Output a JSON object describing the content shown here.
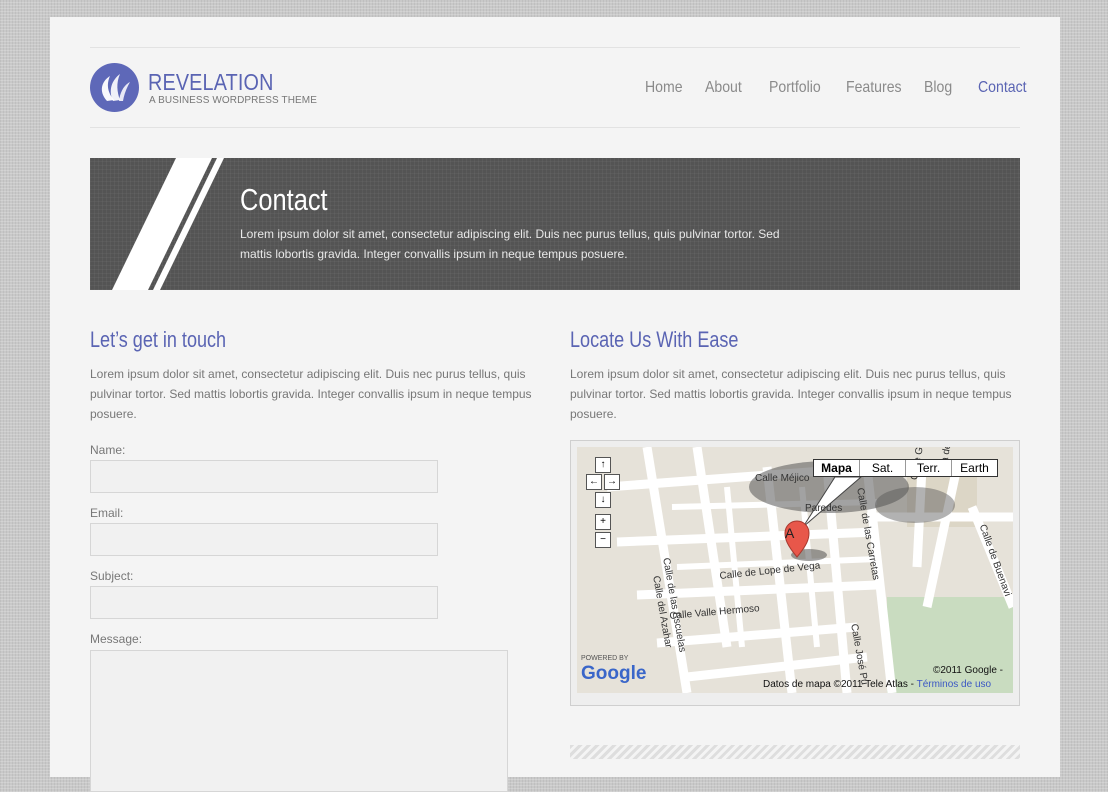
{
  "site": {
    "logo_title": "REVELATION",
    "logo_tagline": "A BUSINESS WORDPRESS THEME"
  },
  "nav": {
    "items": [
      "Home",
      "About",
      "Portfolio",
      "Features",
      "Blog",
      "Contact"
    ],
    "active": "Contact"
  },
  "banner": {
    "title": "Contact",
    "text": "Lorem ipsum dolor sit amet, consectetur adipiscing elit. Duis nec purus tellus, quis pulvinar tortor. Sed mattis lobortis gravida. Integer convallis ipsum in neque tempus posuere."
  },
  "contact": {
    "heading": "Let’s get in touch",
    "text": "Lorem ipsum dolor sit amet, consectetur adipiscing elit. Duis nec purus tellus, quis pulvinar tortor. Sed mattis lobortis gravida. Integer convallis ipsum in neque tempus posuere.",
    "name_label": "Name:",
    "email_label": "Email:",
    "subject_label": "Subject:",
    "message_label": "Message:"
  },
  "locate": {
    "heading": "Locate Us With Ease",
    "text": "Lorem ipsum dolor sit amet, consectetur adipiscing elit. Duis nec purus tellus, quis pulvinar tortor. Sed mattis lobortis gravida. Integer convallis ipsum in neque tempus posuere."
  },
  "map": {
    "types": [
      "Mapa",
      "Sat.",
      "Terr.",
      "Earth"
    ],
    "marker": "A",
    "streets": {
      "mejico": "Calle Méjico",
      "escuelas": "Calle de las Escuelas",
      "azahar": "Calle del Azahar",
      "paredes": "Paredes",
      "carretas": "Calle de las Carretas",
      "garcia": "Calle Garcia",
      "ctra": "Ctra del",
      "buena": "Calle de Buenavi",
      "lope": "Calle de Lope de Vega",
      "valle": "Calle Valle Hermoso",
      "jose": "Calle José Pu"
    },
    "powered_by": "POWERED BY",
    "google": "Google",
    "copyright": "©2011 Google -",
    "data_credit": "Datos de mapa ©2011 Tele Atlas -",
    "terms": "Términos de uso"
  },
  "colors": {
    "accent": "#5a64b3",
    "banner_bg": "#545454",
    "page_bg": "#f4f4f4"
  }
}
